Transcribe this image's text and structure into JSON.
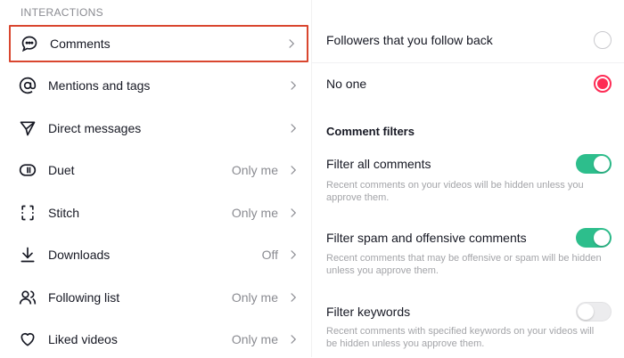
{
  "left_panel": {
    "section_title": "INTERACTIONS",
    "items": [
      {
        "label": "Comments",
        "value": "",
        "icon": "comment-icon"
      },
      {
        "label": "Mentions and tags",
        "value": "",
        "icon": "at-icon"
      },
      {
        "label": "Direct messages",
        "value": "",
        "icon": "send-icon"
      },
      {
        "label": "Duet",
        "value": "Only me",
        "icon": "duet-icon"
      },
      {
        "label": "Stitch",
        "value": "Only me",
        "icon": "stitch-icon"
      },
      {
        "label": "Downloads",
        "value": "Off",
        "icon": "download-icon"
      },
      {
        "label": "Following list",
        "value": "Only me",
        "icon": "people-icon"
      },
      {
        "label": "Liked videos",
        "value": "Only me",
        "icon": "heart-icon"
      }
    ]
  },
  "right_panel": {
    "radio_options": [
      {
        "label": "Followers that you follow back",
        "selected": false
      },
      {
        "label": "No one",
        "selected": true
      }
    ],
    "filters_title": "Comment filters",
    "filters": [
      {
        "label": "Filter all comments",
        "enabled": true,
        "description": "Recent comments on your videos will be hidden unless you approve them."
      },
      {
        "label": "Filter spam and offensive comments",
        "enabled": true,
        "description": "Recent comments that may be offensive or spam will be hidden unless you approve them."
      },
      {
        "label": "Filter keywords",
        "enabled": false,
        "description": "Recent comments with specified keywords on your videos will be hidden unless you approve them."
      }
    ]
  },
  "colors": {
    "highlight_border": "#d9462f",
    "radio_selected": "#fe2c55",
    "toggle_on": "#2dbe8c",
    "muted_text": "#8a8b91"
  }
}
